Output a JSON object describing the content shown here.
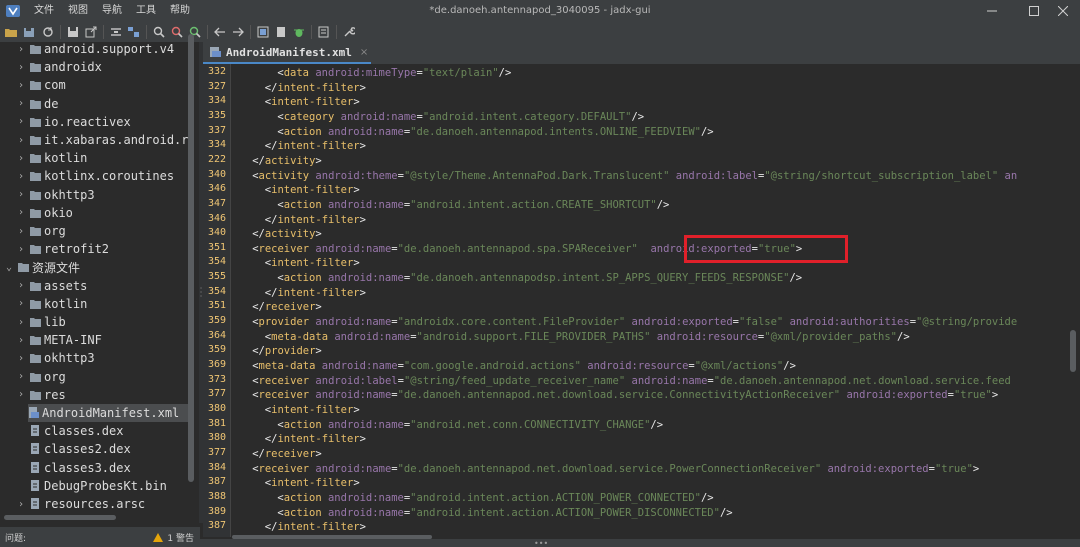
{
  "window": {
    "title": "*de.danoeh.antennapod_3040095 - jadx-gui",
    "controls": [
      "minimize-icon",
      "maximize-icon",
      "close-icon"
    ]
  },
  "menu": [
    "文件",
    "视图",
    "导航",
    "工具",
    "帮助"
  ],
  "toolbar": {
    "icons": [
      "open-folder-icon",
      "save-all-icon",
      "sync-icon",
      "save-icon",
      "export-icon",
      "flatten-icon",
      "sync-tree-icon",
      "search-icon",
      "search-class-icon",
      "find-usage-icon",
      "back-icon",
      "forward-icon",
      "decompile-all-icon",
      "bookmark-icon",
      "log-icon",
      "debug-icon",
      "preferences-icon"
    ]
  },
  "tree": {
    "items": [
      {
        "label": "android.support.v4",
        "indent": 1,
        "kind": "package",
        "expandable": true
      },
      {
        "label": "androidx",
        "indent": 1,
        "kind": "package",
        "expandable": true
      },
      {
        "label": "com",
        "indent": 1,
        "kind": "package",
        "expandable": true
      },
      {
        "label": "de",
        "indent": 1,
        "kind": "package",
        "expandable": true
      },
      {
        "label": "io.reactivex",
        "indent": 1,
        "kind": "package",
        "expandable": true
      },
      {
        "label": "it.xabaras.android.r",
        "indent": 1,
        "kind": "package",
        "expandable": true
      },
      {
        "label": "kotlin",
        "indent": 1,
        "kind": "package",
        "expandable": true
      },
      {
        "label": "kotlinx.coroutines",
        "indent": 1,
        "kind": "package",
        "expandable": true
      },
      {
        "label": "okhttp3",
        "indent": 1,
        "kind": "package",
        "expandable": true
      },
      {
        "label": "okio",
        "indent": 1,
        "kind": "package",
        "expandable": true
      },
      {
        "label": "org",
        "indent": 1,
        "kind": "package",
        "expandable": true
      },
      {
        "label": "retrofit2",
        "indent": 1,
        "kind": "package",
        "expandable": true
      },
      {
        "label": "资源文件",
        "indent": 0,
        "kind": "folder",
        "expandable": true,
        "expanded": true
      },
      {
        "label": "assets",
        "indent": 1,
        "kind": "folder",
        "expandable": true
      },
      {
        "label": "kotlin",
        "indent": 1,
        "kind": "folder",
        "expandable": true
      },
      {
        "label": "lib",
        "indent": 1,
        "kind": "folder",
        "expandable": true
      },
      {
        "label": "META-INF",
        "indent": 1,
        "kind": "folder",
        "expandable": true
      },
      {
        "label": "okhttp3",
        "indent": 1,
        "kind": "folder",
        "expandable": true
      },
      {
        "label": "org",
        "indent": 1,
        "kind": "folder",
        "expandable": true
      },
      {
        "label": "res",
        "indent": 1,
        "kind": "folder",
        "expandable": true
      },
      {
        "label": "AndroidManifest.xml",
        "indent": 1,
        "kind": "manifest",
        "expandable": false,
        "selected": true
      },
      {
        "label": "classes.dex",
        "indent": 1,
        "kind": "file",
        "expandable": false
      },
      {
        "label": "classes2.dex",
        "indent": 1,
        "kind": "file",
        "expandable": false
      },
      {
        "label": "classes3.dex",
        "indent": 1,
        "kind": "file",
        "expandable": false
      },
      {
        "label": "DebugProbesKt.bin",
        "indent": 1,
        "kind": "file",
        "expandable": false
      },
      {
        "label": "resources.arsc",
        "indent": 1,
        "kind": "file",
        "expandable": true
      }
    ]
  },
  "tab": {
    "label": "AndroidManifest.xml",
    "close": "×"
  },
  "status": {
    "label": "问题:",
    "warning": "1 警告"
  },
  "colors": {
    "accent": "#4a88c7",
    "highlight_box": "#e0202a",
    "tag": "#e8bf6a",
    "attr_ns": "#9876aa",
    "value": "#6a8759"
  },
  "code": {
    "lines": [
      {
        "n": "332",
        "i": 4,
        "s": [
          [
            "p",
            "<"
          ],
          [
            "t",
            "data "
          ],
          [
            "an",
            "android:mimeType"
          ],
          [
            "p",
            "="
          ],
          [
            "v",
            "\"text/plain\""
          ],
          [
            "p",
            "/>"
          ]
        ]
      },
      {
        "n": "327",
        "i": 3,
        "s": [
          [
            "p",
            "</"
          ],
          [
            "t",
            "intent-filter"
          ],
          [
            "p",
            ">"
          ]
        ]
      },
      {
        "n": "334",
        "i": 3,
        "s": [
          [
            "p",
            "<"
          ],
          [
            "t",
            "intent-filter"
          ],
          [
            "p",
            ">"
          ]
        ]
      },
      {
        "n": "335",
        "i": 4,
        "s": [
          [
            "p",
            "<"
          ],
          [
            "t",
            "category "
          ],
          [
            "an",
            "android:name"
          ],
          [
            "p",
            "="
          ],
          [
            "v",
            "\"android.intent.category.DEFAULT\""
          ],
          [
            "p",
            "/>"
          ]
        ]
      },
      {
        "n": "337",
        "i": 4,
        "s": [
          [
            "p",
            "<"
          ],
          [
            "t",
            "action "
          ],
          [
            "an",
            "android:name"
          ],
          [
            "p",
            "="
          ],
          [
            "v",
            "\"de.danoeh.antennapod.intents.ONLINE_FEEDVIEW\""
          ],
          [
            "p",
            "/>"
          ]
        ]
      },
      {
        "n": "334",
        "i": 3,
        "s": [
          [
            "p",
            "</"
          ],
          [
            "t",
            "intent-filter"
          ],
          [
            "p",
            ">"
          ]
        ]
      },
      {
        "n": "222",
        "i": 2,
        "s": [
          [
            "p",
            "</"
          ],
          [
            "t",
            "activity"
          ],
          [
            "p",
            ">"
          ]
        ]
      },
      {
        "n": "340",
        "i": 2,
        "s": [
          [
            "p",
            "<"
          ],
          [
            "t",
            "activity "
          ],
          [
            "an",
            "android:theme"
          ],
          [
            "p",
            "="
          ],
          [
            "v",
            "\"@style/Theme.AntennaPod.Dark.Translucent\""
          ],
          [
            "p",
            " "
          ],
          [
            "an",
            "android:label"
          ],
          [
            "p",
            "="
          ],
          [
            "v",
            "\"@string/shortcut_subscription_label\""
          ],
          [
            "p",
            " "
          ],
          [
            "an",
            "an"
          ]
        ]
      },
      {
        "n": "346",
        "i": 3,
        "s": [
          [
            "p",
            "<"
          ],
          [
            "t",
            "intent-filter"
          ],
          [
            "p",
            ">"
          ]
        ]
      },
      {
        "n": "347",
        "i": 4,
        "s": [
          [
            "p",
            "<"
          ],
          [
            "t",
            "action "
          ],
          [
            "an",
            "android:name"
          ],
          [
            "p",
            "="
          ],
          [
            "v",
            "\"android.intent.action.CREATE_SHORTCUT\""
          ],
          [
            "p",
            "/>"
          ]
        ]
      },
      {
        "n": "346",
        "i": 3,
        "s": [
          [
            "p",
            "</"
          ],
          [
            "t",
            "intent-filter"
          ],
          [
            "p",
            ">"
          ]
        ]
      },
      {
        "n": "340",
        "i": 2,
        "s": [
          [
            "p",
            "</"
          ],
          [
            "t",
            "activity"
          ],
          [
            "p",
            ">"
          ]
        ]
      },
      {
        "n": "351",
        "i": 2,
        "s": [
          [
            "p",
            "<"
          ],
          [
            "t",
            "receiver "
          ],
          [
            "an",
            "android:name"
          ],
          [
            "p",
            "="
          ],
          [
            "v",
            "\"de.danoeh.antennapod.spa.SPAReceiver\""
          ],
          [
            "p",
            "  "
          ],
          [
            "an",
            "android:exported"
          ],
          [
            "p",
            "="
          ],
          [
            "v",
            "\"true\""
          ],
          [
            "p",
            ">"
          ]
        ]
      },
      {
        "n": "354",
        "i": 3,
        "s": [
          [
            "p",
            "<"
          ],
          [
            "t",
            "intent-filter"
          ],
          [
            "p",
            ">"
          ]
        ]
      },
      {
        "n": "355",
        "i": 4,
        "s": [
          [
            "p",
            "<"
          ],
          [
            "t",
            "action "
          ],
          [
            "an",
            "android:name"
          ],
          [
            "p",
            "="
          ],
          [
            "v",
            "\"de.danoeh.antennapodsp.intent.SP_APPS_QUERY_FEEDS_RESPONSE\""
          ],
          [
            "p",
            "/>"
          ]
        ]
      },
      {
        "n": "354",
        "i": 3,
        "s": [
          [
            "p",
            "</"
          ],
          [
            "t",
            "intent-filter"
          ],
          [
            "p",
            ">"
          ]
        ]
      },
      {
        "n": "351",
        "i": 2,
        "s": [
          [
            "p",
            "</"
          ],
          [
            "t",
            "receiver"
          ],
          [
            "p",
            ">"
          ]
        ]
      },
      {
        "n": "359",
        "i": 2,
        "s": [
          [
            "p",
            "<"
          ],
          [
            "t",
            "provider "
          ],
          [
            "an",
            "android:name"
          ],
          [
            "p",
            "="
          ],
          [
            "v",
            "\"androidx.core.content.FileProvider\""
          ],
          [
            "p",
            " "
          ],
          [
            "an",
            "android:exported"
          ],
          [
            "p",
            "="
          ],
          [
            "v",
            "\"false\""
          ],
          [
            "p",
            " "
          ],
          [
            "an",
            "android:authorities"
          ],
          [
            "p",
            "="
          ],
          [
            "v",
            "\"@string/provide"
          ]
        ]
      },
      {
        "n": "364",
        "i": 3,
        "s": [
          [
            "p",
            "<"
          ],
          [
            "t",
            "meta-data "
          ],
          [
            "an",
            "android:name"
          ],
          [
            "p",
            "="
          ],
          [
            "v",
            "\"android.support.FILE_PROVIDER_PATHS\""
          ],
          [
            "p",
            " "
          ],
          [
            "an",
            "android:resource"
          ],
          [
            "p",
            "="
          ],
          [
            "v",
            "\"@xml/provider_paths\""
          ],
          [
            "p",
            "/>"
          ]
        ]
      },
      {
        "n": "359",
        "i": 2,
        "s": [
          [
            "p",
            "</"
          ],
          [
            "t",
            "provider"
          ],
          [
            "p",
            ">"
          ]
        ]
      },
      {
        "n": "369",
        "i": 2,
        "s": [
          [
            "p",
            "<"
          ],
          [
            "t",
            "meta-data "
          ],
          [
            "an",
            "android:name"
          ],
          [
            "p",
            "="
          ],
          [
            "v",
            "\"com.google.android.actions\""
          ],
          [
            "p",
            " "
          ],
          [
            "an",
            "android:resource"
          ],
          [
            "p",
            "="
          ],
          [
            "v",
            "\"@xml/actions\""
          ],
          [
            "p",
            "/>"
          ]
        ]
      },
      {
        "n": "373",
        "i": 2,
        "s": [
          [
            "p",
            "<"
          ],
          [
            "t",
            "receiver "
          ],
          [
            "an",
            "android:label"
          ],
          [
            "p",
            "="
          ],
          [
            "v",
            "\"@string/feed_update_receiver_name\""
          ],
          [
            "p",
            " "
          ],
          [
            "an",
            "android:name"
          ],
          [
            "p",
            "="
          ],
          [
            "v",
            "\"de.danoeh.antennapod.net.download.service.feed"
          ]
        ]
      },
      {
        "n": "377",
        "i": 2,
        "s": [
          [
            "p",
            "<"
          ],
          [
            "t",
            "receiver "
          ],
          [
            "an",
            "android:name"
          ],
          [
            "p",
            "="
          ],
          [
            "v",
            "\"de.danoeh.antennapod.net.download.service.ConnectivityActionReceiver\""
          ],
          [
            "p",
            " "
          ],
          [
            "an",
            "android:exported"
          ],
          [
            "p",
            "="
          ],
          [
            "v",
            "\"true\""
          ],
          [
            "p",
            ">"
          ]
        ]
      },
      {
        "n": "380",
        "i": 3,
        "s": [
          [
            "p",
            "<"
          ],
          [
            "t",
            "intent-filter"
          ],
          [
            "p",
            ">"
          ]
        ]
      },
      {
        "n": "381",
        "i": 4,
        "s": [
          [
            "p",
            "<"
          ],
          [
            "t",
            "action "
          ],
          [
            "an",
            "android:name"
          ],
          [
            "p",
            "="
          ],
          [
            "v",
            "\"android.net.conn.CONNECTIVITY_CHANGE\""
          ],
          [
            "p",
            "/>"
          ]
        ]
      },
      {
        "n": "380",
        "i": 3,
        "s": [
          [
            "p",
            "</"
          ],
          [
            "t",
            "intent-filter"
          ],
          [
            "p",
            ">"
          ]
        ]
      },
      {
        "n": "377",
        "i": 2,
        "s": [
          [
            "p",
            "</"
          ],
          [
            "t",
            "receiver"
          ],
          [
            "p",
            ">"
          ]
        ]
      },
      {
        "n": "384",
        "i": 2,
        "s": [
          [
            "p",
            "<"
          ],
          [
            "t",
            "receiver "
          ],
          [
            "an",
            "android:name"
          ],
          [
            "p",
            "="
          ],
          [
            "v",
            "\"de.danoeh.antennapod.net.download.service.PowerConnectionReceiver\""
          ],
          [
            "p",
            " "
          ],
          [
            "an",
            "android:exported"
          ],
          [
            "p",
            "="
          ],
          [
            "v",
            "\"true\""
          ],
          [
            "p",
            ">"
          ]
        ]
      },
      {
        "n": "387",
        "i": 3,
        "s": [
          [
            "p",
            "<"
          ],
          [
            "t",
            "intent-filter"
          ],
          [
            "p",
            ">"
          ]
        ]
      },
      {
        "n": "388",
        "i": 4,
        "s": [
          [
            "p",
            "<"
          ],
          [
            "t",
            "action "
          ],
          [
            "an",
            "android:name"
          ],
          [
            "p",
            "="
          ],
          [
            "v",
            "\"android.intent.action.ACTION_POWER_CONNECTED\""
          ],
          [
            "p",
            "/>"
          ]
        ]
      },
      {
        "n": "389",
        "i": 4,
        "s": [
          [
            "p",
            "<"
          ],
          [
            "t",
            "action "
          ],
          [
            "an",
            "android:name"
          ],
          [
            "p",
            "="
          ],
          [
            "v",
            "\"android.intent.action.ACTION_POWER_DISCONNECTED\""
          ],
          [
            "p",
            "/>"
          ]
        ]
      },
      {
        "n": "387",
        "i": 3,
        "s": [
          [
            "p",
            "</"
          ],
          [
            "t",
            "intent-filter"
          ],
          [
            "p",
            ">"
          ]
        ]
      }
    ]
  }
}
